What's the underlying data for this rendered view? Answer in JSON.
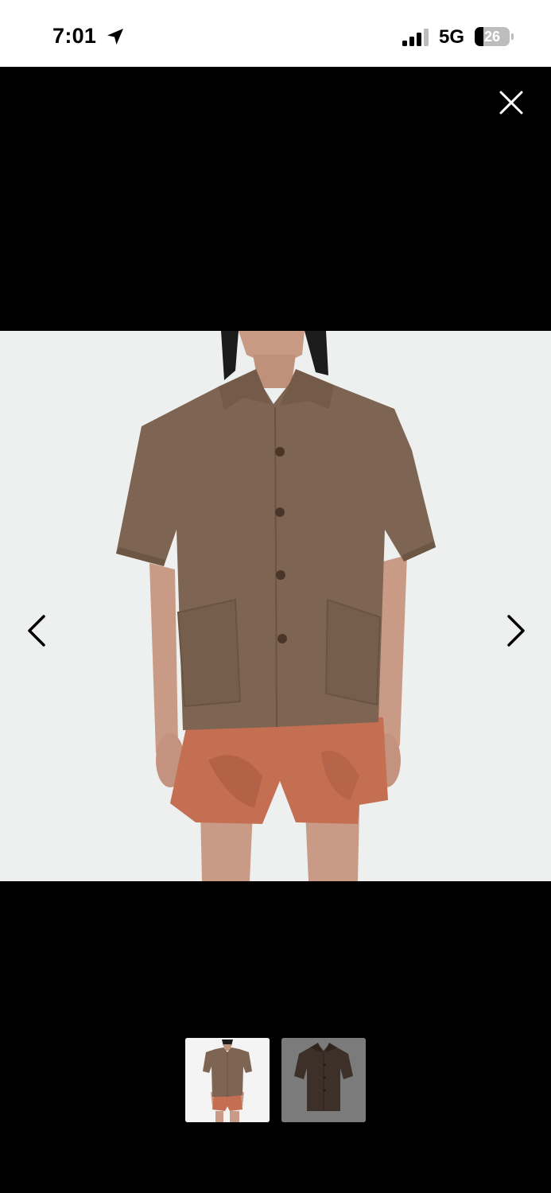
{
  "status_bar": {
    "time": "7:01",
    "network": "5G",
    "battery_level": "26",
    "battery_fraction": 0.26
  },
  "viewer": {
    "close_icon": "close-icon",
    "prev_icon": "chevron-left-icon",
    "next_icon": "chevron-right-icon",
    "selected_thumbnail": 1,
    "thumbnail_count": 2
  },
  "colors": {
    "shirt": "#7e6553",
    "shorts": "#c46e52",
    "image_background": "#eef0ef",
    "selected_thumb_bg": "#f4f4f4",
    "unselected_thumb_bg": "#7b7b7b",
    "dark_shirt": "#3d3029"
  }
}
